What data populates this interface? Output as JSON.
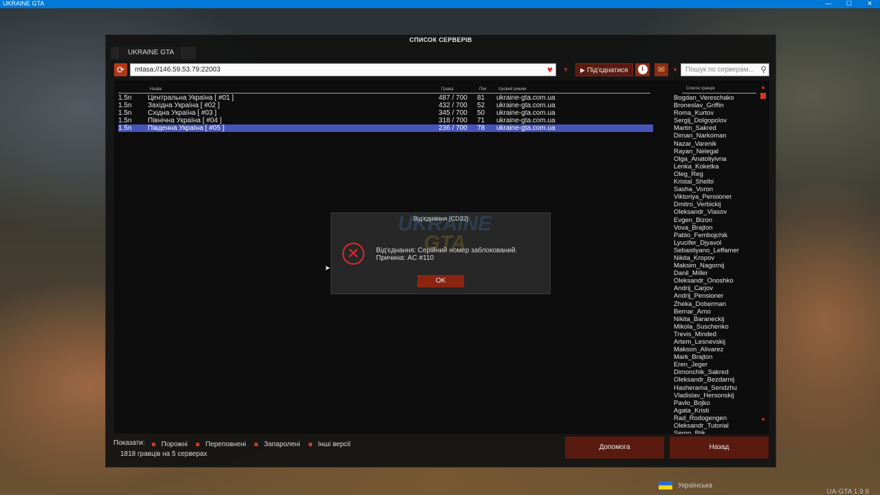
{
  "os": {
    "title": "UKRAINE GTA",
    "minimize": "—",
    "maximize": "☐",
    "close": "✕"
  },
  "window": {
    "title": "СПИСОК СЕРВЕРІВ",
    "tab": "UKRAINE GTA"
  },
  "toolbar": {
    "address": "mtasa://146.59.53.79:22003",
    "connect_label": "Під'єднатися",
    "search_placeholder": "Пошук по серверам..."
  },
  "columns": {
    "name": "Назва",
    "players": "Гравці",
    "ping": "Пінг",
    "mode": "Ігровий режим",
    "player_list": "Список гравців"
  },
  "servers": [
    {
      "version": "1.5n",
      "name": "Центральна Україна [ #01 ]",
      "players": "487 / 700",
      "ping": "81",
      "mode": "ukraine-gta.com.ua"
    },
    {
      "version": "1.5n",
      "name": "Західна Україна [ #02 ]",
      "players": "432 / 700",
      "ping": "52",
      "mode": "ukraine-gta.com.ua"
    },
    {
      "version": "1.5n",
      "name": "Східна Україна [ #03 ]",
      "players": "345 / 700",
      "ping": "50",
      "mode": "ukraine-gta.com.ua"
    },
    {
      "version": "1.5n",
      "name": "Північна Україна [ #04 ]",
      "players": "318 / 700",
      "ping": "71",
      "mode": "ukraine-gta.com.ua"
    },
    {
      "version": "1.5n",
      "name": "Південна Україна [ #05 ]",
      "players": "236 / 700",
      "ping": "78",
      "mode": "ukraine-gta.com.ua"
    }
  ],
  "players": [
    "Bogdan_Vereschako",
    "Broneslav_Griffin",
    "Roma_Kurtov",
    "Sergij_Dolgopolov",
    "Martin_Sakred",
    "Diman_Narkoman",
    "Nazar_Varenik",
    "Rayan_Nelegal",
    "Olga_Anatoliyivna",
    "Lenka_Koketka",
    "Oleg_Reg",
    "Kristal_Shelbi",
    "Sasha_Voron",
    "Viktoriya_Pensioner",
    "Dmitro_Verbickij",
    "Oleksandr_Vlasov",
    "Evgen_Bizon",
    "Vova_Brajton",
    "Pablo_Fembojchik",
    "Lyucifer_Djyavol",
    "Sebastiyano_Leffamer",
    "Nikita_Kropov",
    "Maksim_Nagornij",
    "Danil_Miller",
    "Oleksandr_Onoshko",
    "Andrij_Carjov",
    "Andrij_Pensioner",
    "Zheka_Doberman",
    "Bernar_Arno",
    "Nikita_Baraneckij",
    "Mikola_Suschenko",
    "Trevis_Minded",
    "Artem_Lesnevskij",
    "Makson_Alivarez",
    "Mark_Brajton",
    "Eren_Jeger",
    "Dimonchik_Sakred",
    "Oleksandr_Bezdarnij",
    "Hasherama_Sendzhu",
    "Vladislav_Hersonskij",
    "Pavlo_Bojko",
    "Agata_Kristi",
    "Rad_Rodogengen",
    "Oleksandr_Tutorial",
    "Sergo_Blik"
  ],
  "footer": {
    "show_label": "Показати:",
    "filters": [
      "Порожні",
      "Переповнені",
      "Запаролені",
      "Інші версії"
    ],
    "players_count": "1818 гравців на 5 серверах",
    "help": "Допомога",
    "back": "Назад"
  },
  "dialog": {
    "title": "Від'єднання [CD32]",
    "line1": "Від'єднання: Серійний номер заблокований.",
    "line2": "Причина: AC #110",
    "ok": "OK",
    "watermark_top": "UKRAINE",
    "watermark_bottom": "GTA"
  },
  "language": "Українська",
  "version": "UA-GTA 1.9.8",
  "colors": {
    "accent": "#d03a1a",
    "selected_row": "#4754b8",
    "button": "#5a1a10",
    "titlebar": "#0078d7"
  }
}
